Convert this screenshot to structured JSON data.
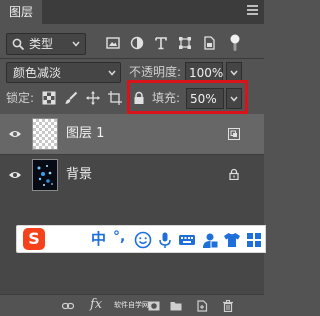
{
  "panel": {
    "tab_label": "图层"
  },
  "filter": {
    "kind_label": "类型"
  },
  "blend": {
    "mode": "颜色减淡",
    "opacity_label": "不透明度:",
    "opacity_value": "100%"
  },
  "lock": {
    "label": "锁定:",
    "fill_label": "填充:",
    "fill_value": "50%"
  },
  "layers": [
    {
      "name": "图层 1",
      "selected": true,
      "visible": true,
      "badge": "smart-object-icon"
    },
    {
      "name": "背景",
      "selected": false,
      "visible": true,
      "badge": "lock-icon"
    }
  ],
  "ime": {
    "logo": "S",
    "mode": "中",
    "punct": "°,"
  },
  "bottom": {
    "fx_label": "fx",
    "watermark": "软件自学网"
  },
  "colors": {
    "panel_bg": "#535353",
    "list_bg": "#474747",
    "selected_row": "#676767",
    "highlight_box": "#d8141a",
    "ime_logo": "#f5421b",
    "ime_blue": "#1e6fd9"
  }
}
